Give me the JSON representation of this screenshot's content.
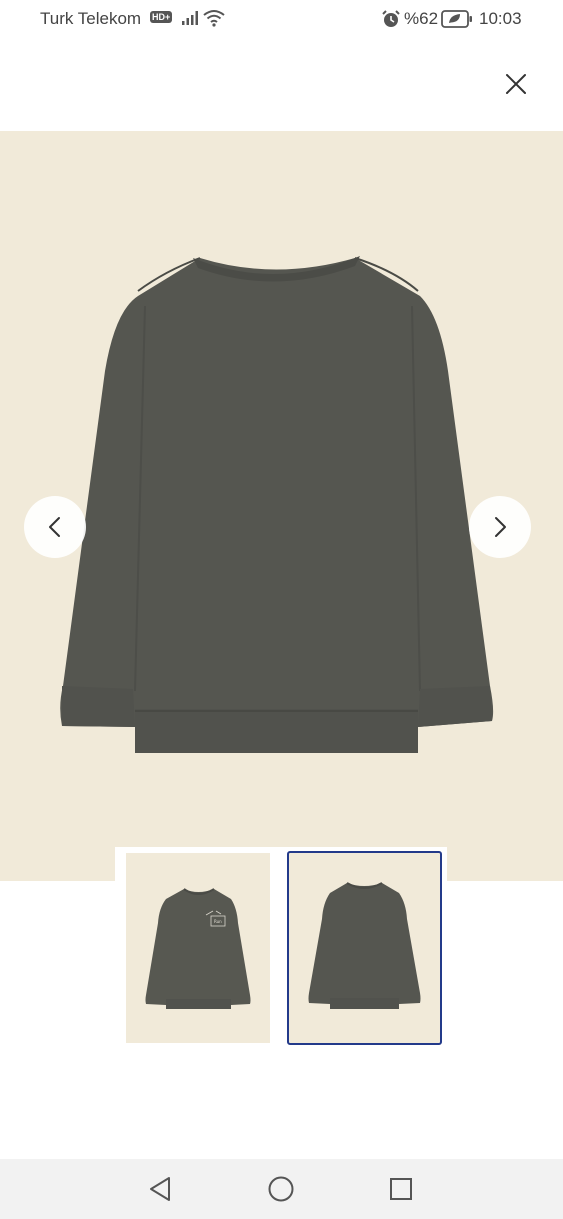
{
  "status_bar": {
    "carrier": "Turk Telekom",
    "hd_badge": "HD+",
    "battery_percent": "%62",
    "time": "10:03"
  },
  "gallery": {
    "selected_index": 1,
    "thumbnail_count": 2,
    "accent_color": "#233a8a",
    "background_color": "#f1ead9",
    "garment_color": "#555650"
  }
}
